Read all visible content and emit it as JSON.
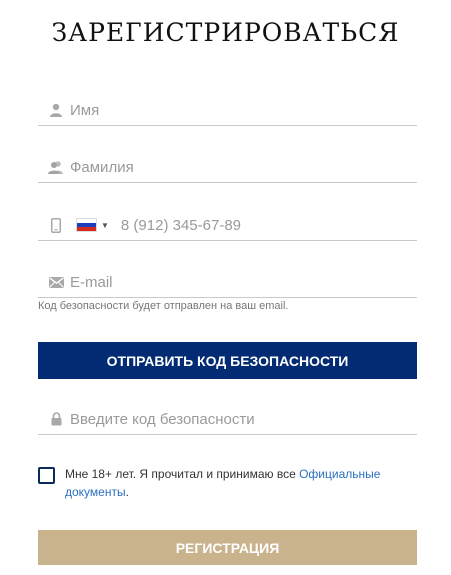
{
  "title": "ЗАРЕГИСТРИРОВАТЬСЯ",
  "fields": {
    "name": {
      "placeholder": "Имя",
      "icon": "person-icon"
    },
    "surname": {
      "placeholder": "Фамилия",
      "icon": "people-icon"
    },
    "phone": {
      "placeholder": "8 (912) 345-67-89",
      "icon": "mobile-phone-icon",
      "country": "Russia"
    },
    "email": {
      "placeholder": "E-mail",
      "icon": "envelope-icon"
    },
    "code": {
      "placeholder": "Введите код безопасности",
      "icon": "lock-icon"
    }
  },
  "email_hint": "Код безопасности будет отправлен на ваш email.",
  "send_code_button": "ОТПРАВИТЬ КОД БЕЗОПАСНОСТИ",
  "agreement": {
    "text": "Мне 18+ лет. Я прочитал и принимаю все ",
    "link": "Официальные документы",
    "suffix": ".",
    "checked": false
  },
  "register_button": "РЕГИСТРАЦИЯ",
  "colors": {
    "primary_button": "#032b73",
    "register_button": "#c8b38c",
    "link": "#2a6fbf",
    "checkbox_border": "#0b2a5b"
  }
}
